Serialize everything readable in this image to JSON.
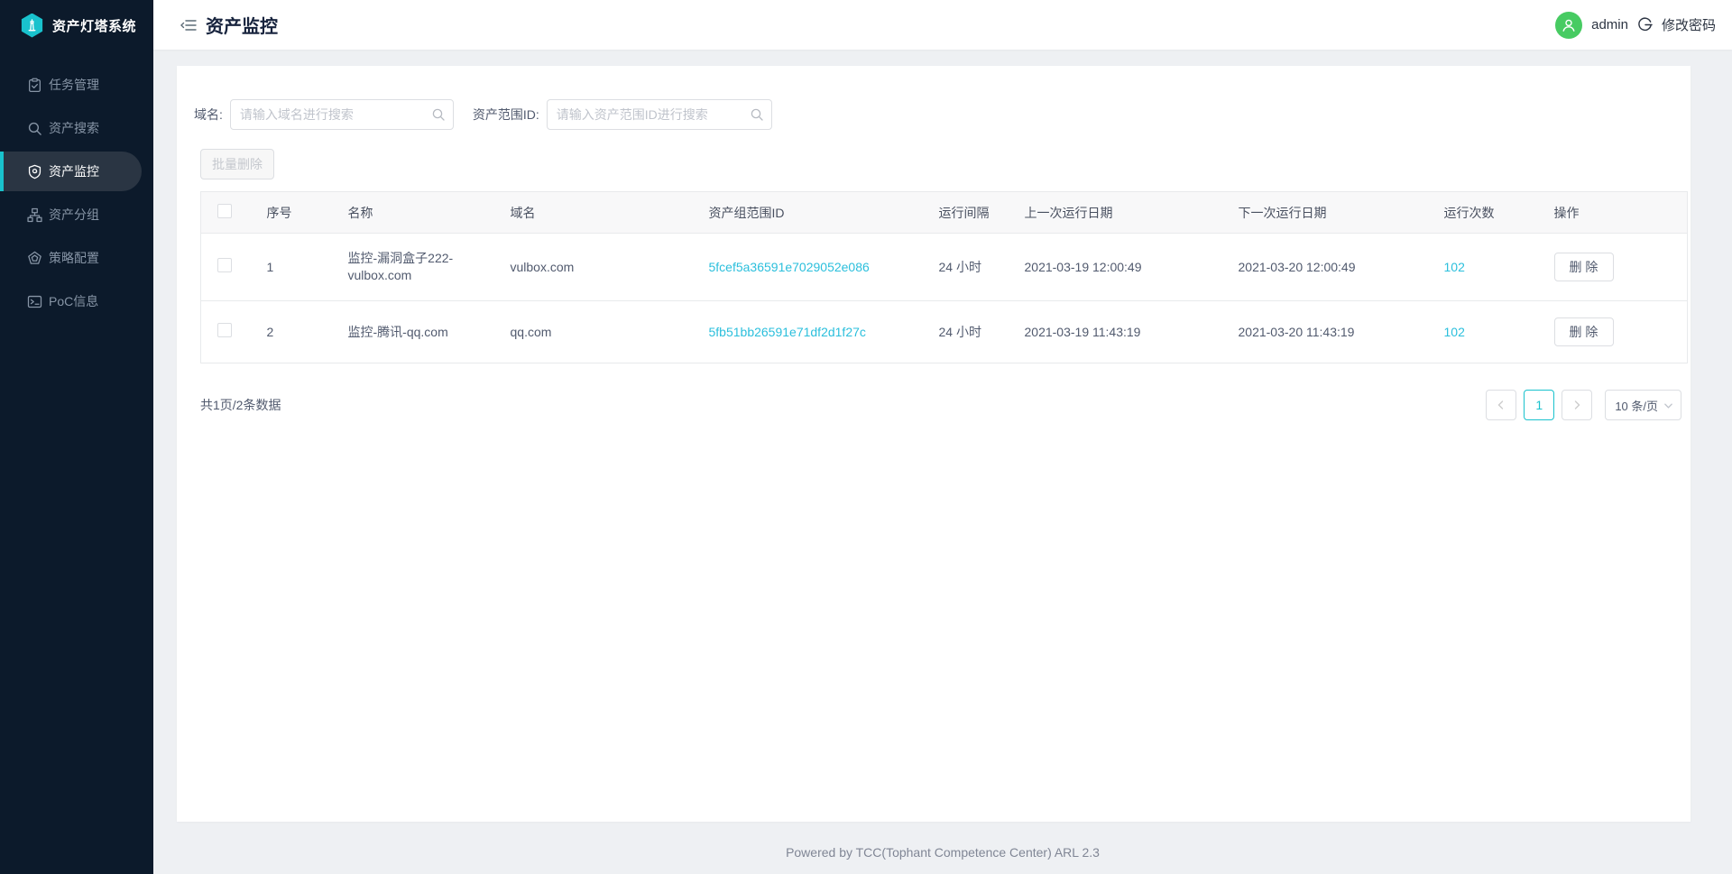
{
  "app": {
    "name": "资产灯塔系统"
  },
  "sidebar": {
    "items": [
      {
        "label": "任务管理",
        "icon": "clipboard-icon",
        "active": false
      },
      {
        "label": "资产搜索",
        "icon": "search-icon",
        "active": false
      },
      {
        "label": "资产监控",
        "icon": "shield-icon",
        "active": true
      },
      {
        "label": "资产分组",
        "icon": "sitemap-icon",
        "active": false
      },
      {
        "label": "策略配置",
        "icon": "badge-icon",
        "active": false
      },
      {
        "label": "PoC信息",
        "icon": "terminal-icon",
        "active": false
      }
    ]
  },
  "header": {
    "title": "资产监控",
    "user": "admin",
    "change_password": "修改密码"
  },
  "filters": {
    "domain_label": "域名:",
    "domain_placeholder": "请输入域名进行搜索",
    "domain_value": "",
    "scope_label": "资产范围ID:",
    "scope_placeholder": "请输入资产范围ID进行搜索",
    "scope_value": ""
  },
  "toolbar": {
    "batch_delete_label": "批量删除"
  },
  "table": {
    "headers": [
      "序号",
      "名称",
      "域名",
      "资产组范围ID",
      "运行间隔",
      "上一次运行日期",
      "下一次运行日期",
      "运行次数",
      "操作"
    ],
    "action_label": "删 除",
    "rows": [
      {
        "index": "1",
        "name": "监控-漏洞盒子222-vulbox.com",
        "domain": "vulbox.com",
        "scope_id": "5fcef5a36591e7029052e086",
        "interval": "24 小时",
        "last_run": "2021-03-19 12:00:49",
        "next_run": "2021-03-20 12:00:49",
        "run_count": "102"
      },
      {
        "index": "2",
        "name": "监控-腾讯-qq.com",
        "domain": "qq.com",
        "scope_id": "5fb51bb26591e71df2d1f27c",
        "interval": "24 小时",
        "last_run": "2021-03-19 11:43:19",
        "next_run": "2021-03-20 11:43:19",
        "run_count": "102"
      }
    ]
  },
  "pagination": {
    "summary": "共1页/2条数据",
    "current_page": "1",
    "page_size": "10 条/页"
  },
  "footer": {
    "text": "Powered by TCC(Tophant Competence Center) ARL 2.3"
  },
  "colors": {
    "accent": "#19c2cd",
    "link": "#2bbfdc",
    "avatar_green": "#47cb62",
    "sidebar_bg": "#0c1a2b"
  }
}
